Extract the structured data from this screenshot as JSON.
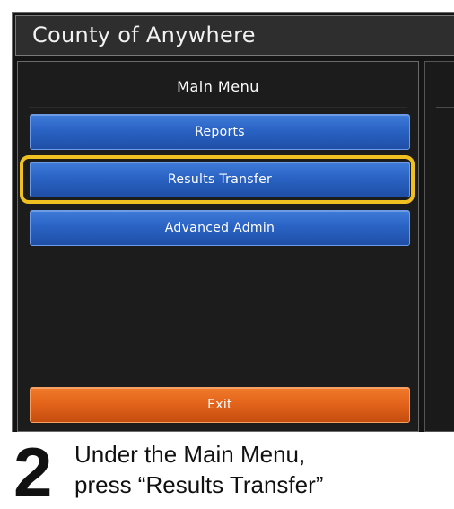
{
  "window": {
    "title": "County of Anywhere"
  },
  "main_menu": {
    "title": "Main Menu",
    "buttons": [
      {
        "label": "Reports"
      },
      {
        "label": "Results Transfer"
      },
      {
        "label": "Advanced Admin"
      }
    ],
    "exit_label": "Exit"
  },
  "instruction": {
    "step": "2",
    "line1": "Under the Main Menu,",
    "line2": "press  “Results Transfer”"
  },
  "colors": {
    "button_blue": "#2a63c4",
    "button_orange": "#e2621a",
    "highlight": "#f0c020",
    "background": "#141414"
  }
}
